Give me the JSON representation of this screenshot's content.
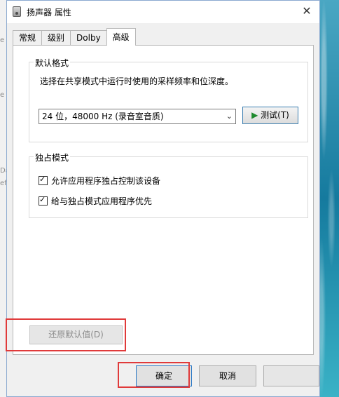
{
  "window": {
    "title": "扬声器 属性",
    "close_glyph": "✕"
  },
  "background": {
    "left_text_1": "e",
    "left_text_2": "e",
    "left_text_3": "Dε",
    "left_text_4": "efi"
  },
  "tabs": [
    {
      "label": "常规"
    },
    {
      "label": "级别"
    },
    {
      "label": "Dolby"
    },
    {
      "label": "高级"
    }
  ],
  "default_format": {
    "group_label": "默认格式",
    "description": "选择在共享模式中运行时使用的采样频率和位深度。",
    "selected_value": "24 位，48000 Hz (录音室音质)",
    "test_label": "测试(T)",
    "test_icon": "play-icon"
  },
  "exclusive_mode": {
    "group_label": "独占模式",
    "options": [
      {
        "label": "允许应用程序独占控制该设备",
        "checked": true
      },
      {
        "label": "给与独占模式应用程序优先",
        "checked": true
      }
    ]
  },
  "buttons": {
    "restore_defaults": "还原默认值(D)",
    "ok": "确定",
    "cancel": "取消"
  },
  "colors": {
    "highlight_red": "#e03a3a",
    "play_green": "#1e8a2e",
    "focus_blue": "#2b79c6"
  }
}
